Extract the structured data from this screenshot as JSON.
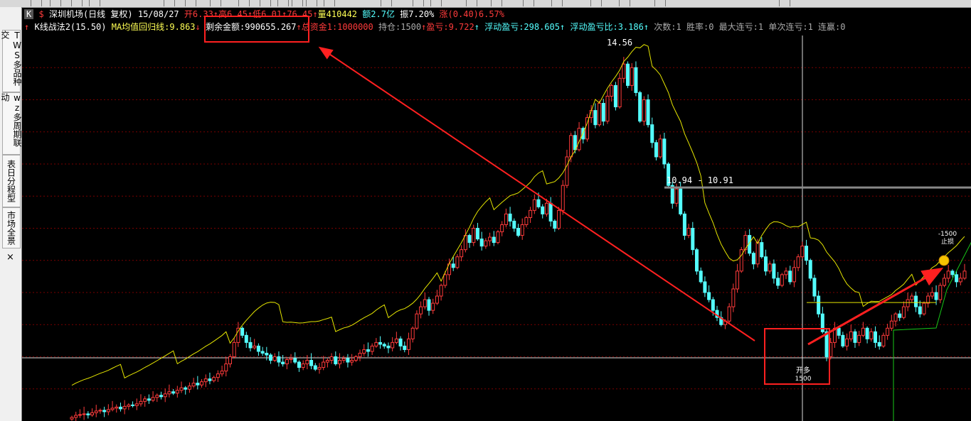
{
  "toolbar": {
    "buttons": [
      "back-button",
      "forward-button",
      "cursor-button",
      "draw-button",
      "zoom-in-button",
      "zoom-out-button",
      "settings-button",
      "arrow-button",
      "line-button"
    ]
  },
  "side_tabs": [
    {
      "label": "TWS多品种交"
    },
    {
      "label": "wz多周期联动"
    },
    {
      "label": "表日分程型"
    },
    {
      "label": "市场全景"
    }
  ],
  "side_close": "×",
  "header": {
    "badge": "K",
    "name_prefix": "$",
    "stock_title": "深圳机场(日线 复权)",
    "date": "15/08/27",
    "open": "开6.33",
    "high": "高6.45",
    "low": "低6.01",
    "close": "76.45",
    "volume": "量410442",
    "amount": "额2.7亿",
    "amplitude": "振7.20%",
    "change": "涨(0.40)6.57%"
  },
  "strategy": {
    "title": "K线战法2(15.50)",
    "ma_label": "MA均值回归线:9.863",
    "remaining": "剩余金额:990655.267",
    "total_capital": "总资金1:1000000",
    "position": "持仓:1500",
    "pnl": "盈亏:9.722",
    "float_pnl": "浮动盈亏:298.605",
    "float_ratio": "浮动盈亏比:3.186",
    "count": "次数:1",
    "win_rate": "胜率:0",
    "max_loss_streak": "最大连亏:1",
    "single_loss_streak": "单次连亏:1",
    "win_streak": "连赢:0"
  },
  "colors": {
    "up": "#ff3b3b",
    "down": "#54ffff",
    "ma": "#e6e600",
    "stop": "#18c818",
    "annot": "#ff2020",
    "text_white": "#ffffff",
    "text_yellow": "#ffff54"
  },
  "chart_data": {
    "type": "candlestick",
    "title": "深圳机场(日线 复权)",
    "ylim": [
      4.4,
      15.2
    ],
    "high_label": "14.56",
    "level_label": "10.94 - 10.91",
    "level_values": [
      10.94,
      10.91
    ],
    "entry_price": 6.25,
    "stop_price": 7.6,
    "buy_label": [
      "开多",
      "1500"
    ],
    "stop_label": [
      "-1500",
      "止损"
    ],
    "closes": [
      4.5,
      4.56,
      4.58,
      4.6,
      4.57,
      4.63,
      4.68,
      4.7,
      4.66,
      4.72,
      4.76,
      4.79,
      4.74,
      4.81,
      4.85,
      4.83,
      4.88,
      4.95,
      5.02,
      4.98,
      5.06,
      5.12,
      5.08,
      5.16,
      5.22,
      5.18,
      5.26,
      5.33,
      5.29,
      5.38,
      5.46,
      5.41,
      5.5,
      5.58,
      5.53,
      5.62,
      5.72,
      5.8,
      6.0,
      6.2,
      6.6,
      7.0,
      6.8,
      6.6,
      6.45,
      6.5,
      6.35,
      6.3,
      6.25,
      6.1,
      6.2,
      6.05,
      6.0,
      6.12,
      6.15,
      6.05,
      5.9,
      6.0,
      6.1,
      5.95,
      5.85,
      5.9,
      6.05,
      6.1,
      6.2,
      6.0,
      6.1,
      6.15,
      6.05,
      6.1,
      6.2,
      6.3,
      6.4,
      6.35,
      6.5,
      6.6,
      6.55,
      6.5,
      6.45,
      6.6,
      6.7,
      6.5,
      6.4,
      6.7,
      7.0,
      7.4,
      7.6,
      7.8,
      7.5,
      7.7,
      7.9,
      8.2,
      8.5,
      8.8,
      8.7,
      9.0,
      9.2,
      9.6,
      9.4,
      9.8,
      9.5,
      9.3,
      9.45,
      9.55,
      9.4,
      9.7,
      9.9,
      10.2,
      10.0,
      9.8,
      9.6,
      9.9,
      10.1,
      10.3,
      10.6,
      10.4,
      10.2,
      10.5,
      10.0,
      9.8,
      10.3,
      11.0,
      11.8,
      12.4,
      12.0,
      12.6,
      12.3,
      12.9,
      13.1,
      12.7,
      13.3,
      12.8,
      13.5,
      13.8,
      13.2,
      14.0,
      14.4,
      13.8,
      14.3,
      13.6,
      12.8,
      13.4,
      12.7,
      12.2,
      11.8,
      12.3,
      11.6,
      11.0,
      10.5,
      10.9,
      10.2,
      9.6,
      9.8,
      9.2,
      8.6,
      8.3,
      8.0,
      7.8,
      7.5,
      7.3,
      7.1,
      7.2,
      7.6,
      8.1,
      8.6,
      9.2,
      9.6,
      9.1,
      8.8,
      9.4,
      9.0,
      8.6,
      8.8,
      8.4,
      8.2,
      8.5,
      8.6,
      8.3,
      8.7,
      9.0,
      9.3,
      8.9,
      8.4,
      7.9,
      7.4,
      6.9,
      6.2,
      6.6,
      7.0,
      6.8,
      6.5,
      6.7,
      6.9,
      6.6,
      6.8,
      7.0,
      6.7,
      6.9,
      6.6,
      6.5,
      6.8,
      7.0,
      7.2,
      7.4,
      7.3,
      7.6,
      7.8,
      7.9,
      7.6,
      7.4,
      7.7,
      7.9,
      8.0,
      7.8,
      8.2,
      8.4,
      8.6,
      8.5,
      8.3,
      8.4,
      8.6
    ]
  }
}
